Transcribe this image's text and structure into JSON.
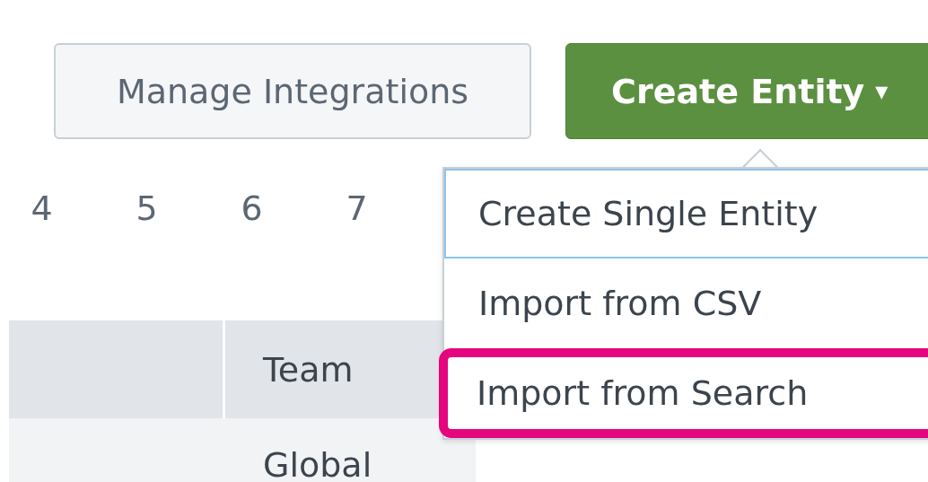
{
  "toolbar": {
    "buttons": [
      {
        "label": "Manage Integrations",
        "kind": "secondary"
      },
      {
        "label": "Create Entity",
        "kind": "primary",
        "caret": "▾"
      }
    ]
  },
  "pagination": {
    "pages": [
      "4",
      "5",
      "6",
      "7"
    ]
  },
  "table": {
    "columns": [
      "Team"
    ],
    "rows": [
      {
        "team": "Global"
      }
    ]
  },
  "dropdown": {
    "items": [
      {
        "label": "Create Single Entity",
        "focused": true,
        "highlighted": false
      },
      {
        "label": "Import from CSV",
        "focused": false,
        "highlighted": false
      },
      {
        "label": "Import from Search",
        "focused": false,
        "highlighted": true
      }
    ]
  }
}
